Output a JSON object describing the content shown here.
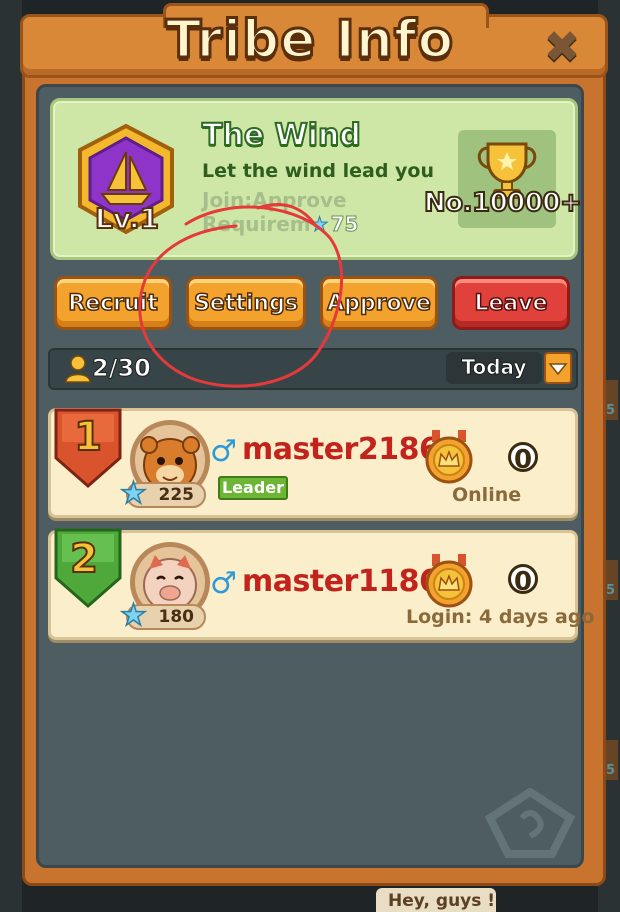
{
  "header": {
    "title": "Tribe Info",
    "close_icon": "close-icon"
  },
  "tribe": {
    "name": "The Wind",
    "motto": "Let the wind lead you",
    "join_label": "Join:Approve",
    "requirement_label": "Requirem",
    "requirement_value": "75",
    "level": "Lv.1",
    "rank": "No.10000+",
    "emblem_icon": "sailboat-icon",
    "rank_icon": "trophy-icon"
  },
  "actions": {
    "recruit": "Recruit",
    "settings": "Settings",
    "approve": "Approve",
    "leave": "Leave"
  },
  "members_bar": {
    "count": "2/30",
    "filter": "Today",
    "member_icon": "person-icon"
  },
  "members": [
    {
      "rank": "1",
      "name": "master2186..",
      "stars": "225",
      "badge": "Leader",
      "score": "0",
      "status": "Online",
      "shield_color": "#d9532d",
      "avatar": "hamster-avatar"
    },
    {
      "rank": "2",
      "name": "master1186..",
      "stars": "180",
      "badge": "",
      "score": "0",
      "status": "Login: 4 days ago",
      "shield_color": "#4fa83a",
      "avatar": "pig-avatar"
    }
  ],
  "chat_preview": "Hey, guys !",
  "colors": {
    "panel_orange": "#c8742e",
    "panel_slate": "#4e5d62",
    "card_green": "#cfe7a6",
    "row_cream": "#fbeecb",
    "name_red": "#c2231b",
    "button_orange": "#f3a22e",
    "button_red": "#e0413a",
    "annotation_red": "#e53a3a"
  }
}
